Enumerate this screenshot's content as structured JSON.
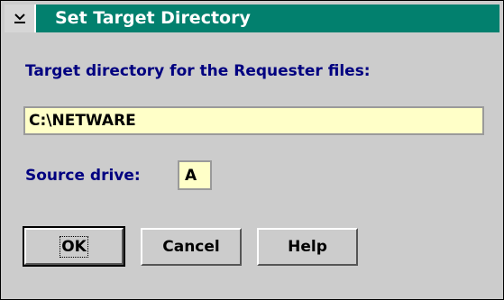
{
  "window": {
    "title": "Set Target Directory",
    "system_menu_icon": "system-menu-icon",
    "title_bar_color": "#02806e"
  },
  "target": {
    "label": "Target directory for the Requester files:",
    "value": "C:\\NETWARE"
  },
  "source": {
    "label": "Source drive:",
    "value": "A"
  },
  "buttons": {
    "ok": "OK",
    "cancel": "Cancel",
    "help": "Help"
  }
}
